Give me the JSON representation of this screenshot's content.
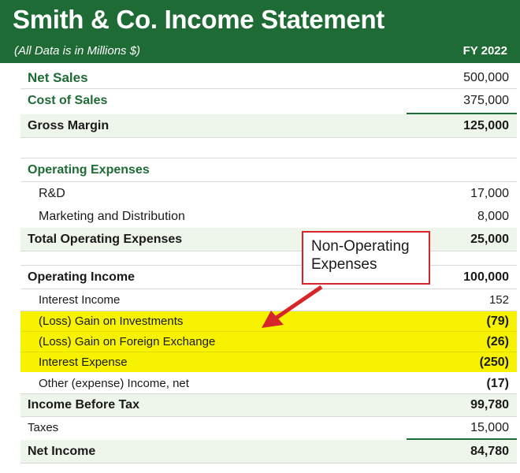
{
  "header": {
    "title": "Smith & Co. Income Statement",
    "subtitle": "(All Data is in Millions $)",
    "period": "FY 2022"
  },
  "rows": [
    {
      "label": "Net Sales",
      "value": "500,000"
    },
    {
      "label": "Cost of Sales",
      "value": "375,000"
    },
    {
      "label": "Gross Margin",
      "value": "125,000"
    },
    {
      "label": "",
      "value": ""
    },
    {
      "label": "Operating Expenses",
      "value": ""
    },
    {
      "label": "R&D",
      "value": "17,000"
    },
    {
      "label": "Marketing and Distribution",
      "value": "8,000"
    },
    {
      "label": "Total Operating Expenses",
      "value": "25,000"
    },
    {
      "label": "",
      "value": ""
    },
    {
      "label": "Operating Income",
      "value": "100,000"
    },
    {
      "label": "Interest Income",
      "value": "152"
    },
    {
      "label": "(Loss) Gain on Investments",
      "value": "(79)"
    },
    {
      "label": "(Loss) Gain on Foreign Exchange",
      "value": "(26)"
    },
    {
      "label": "Interest Expense",
      "value": "(250)"
    },
    {
      "label": "Other (expense) Income, net",
      "value": "(17)"
    },
    {
      "label": "Income Before Tax",
      "value": "99,780"
    },
    {
      "label": "Taxes",
      "value": "15,000"
    },
    {
      "label": "Net Income",
      "value": "84,780"
    }
  ],
  "callout": {
    "line1": "Non-Operating",
    "line2": "Expenses"
  },
  "colors": {
    "brand_green": "#1f6b35",
    "highlight_yellow": "#f7f200",
    "shade_green": "#eef5ea",
    "callout_red": "#d7262a"
  }
}
